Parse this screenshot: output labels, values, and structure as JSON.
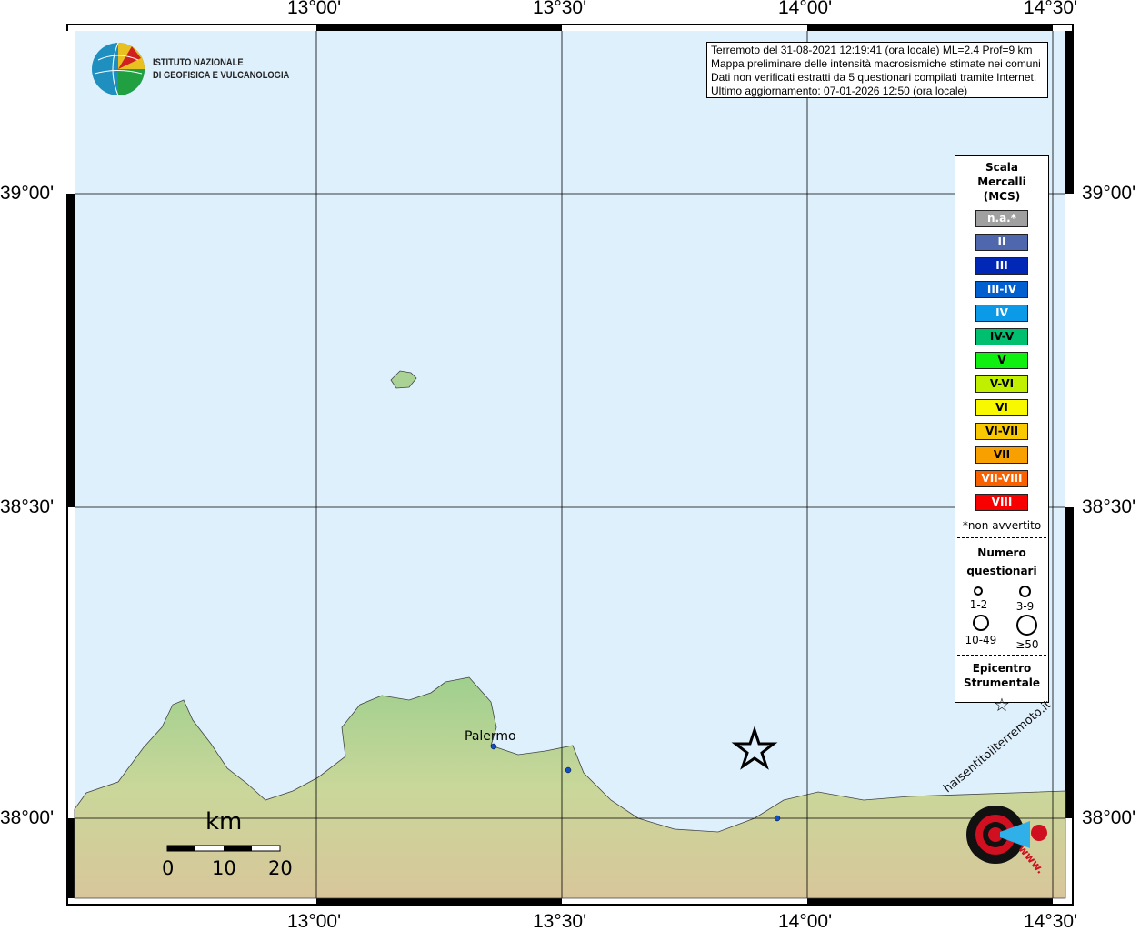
{
  "axes": {
    "lon_labels": [
      "13°00'",
      "13°30'",
      "14°00'",
      "14°30'"
    ],
    "lat_labels": [
      "39°00'",
      "38°30'",
      "38°00'"
    ]
  },
  "logo": {
    "line1": "ISTITUTO NAZIONALE",
    "line2": "DI GEOFISICA E VULCANOLOGIA"
  },
  "info": {
    "line1": "Terremoto del 31-08-2021 12:19:41 (ora locale) ML=2.4 Prof=9 km",
    "line2": "Mappa preliminare delle intensità macrosismiche stimate nei comuni",
    "line3": "Dati non verificati estratti da 5 questionari compilati tramite Internet.",
    "line4": "Ultimo aggiornamento: 07-01-2026 12:50 (ora locale)"
  },
  "legend": {
    "title": [
      "Scala",
      "Mercalli",
      "(MCS)"
    ],
    "scale": [
      {
        "label": "n.a.*",
        "color": "#a0a0a0"
      },
      {
        "label": "II",
        "color": "#4f68ad"
      },
      {
        "label": "III",
        "color": "#0027b5"
      },
      {
        "label": "III-IV",
        "color": "#0060d0"
      },
      {
        "label": "IV",
        "color": "#0a9ae8"
      },
      {
        "label": "IV-V",
        "color": "#00c070"
      },
      {
        "label": "V",
        "color": "#10f010"
      },
      {
        "label": "V-VI",
        "color": "#c0f000"
      },
      {
        "label": "VI",
        "color": "#f8f800"
      },
      {
        "label": "VI-VII",
        "color": "#f8c800"
      },
      {
        "label": "VII",
        "color": "#f8a000"
      },
      {
        "label": "VII-VIII",
        "color": "#f86000"
      },
      {
        "label": "VIII",
        "color": "#f80000"
      }
    ],
    "footnote": "*non avvertito",
    "count_title": [
      "Numero",
      "questionari"
    ],
    "counts": [
      "1-2",
      "3-9",
      "10-49",
      "≥50"
    ],
    "epi_title": [
      "Epicentro",
      "Strumentale"
    ],
    "epi_symbol": "☆"
  },
  "places": {
    "palermo": "Palermo"
  },
  "scalebar": {
    "unit": "km",
    "ticks": [
      "0",
      "10",
      "20"
    ]
  },
  "badge": {
    "text": "haisentitoilterremoto.it",
    "www": "www."
  }
}
